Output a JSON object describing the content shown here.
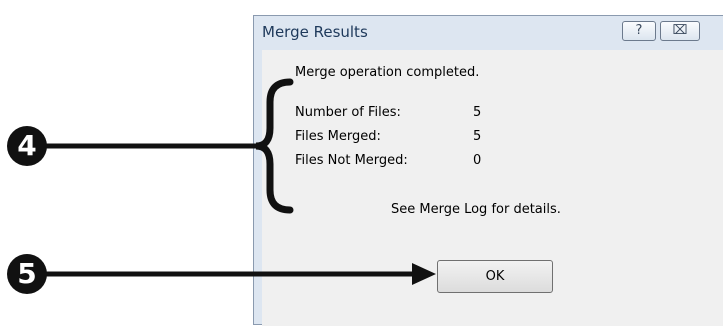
{
  "dialog": {
    "title": "Merge Results",
    "help_label": "?",
    "close_label": "⌧",
    "message": "Merge operation completed.",
    "stats": [
      {
        "label": "Number of Files:",
        "value": "5"
      },
      {
        "label": "Files Merged:",
        "value": "5"
      },
      {
        "label": "Files Not Merged:",
        "value": "0"
      }
    ],
    "footer_note": "See Merge Log for details.",
    "ok_label": "OK"
  },
  "callouts": {
    "brace_number": "4",
    "ok_number": "5"
  }
}
